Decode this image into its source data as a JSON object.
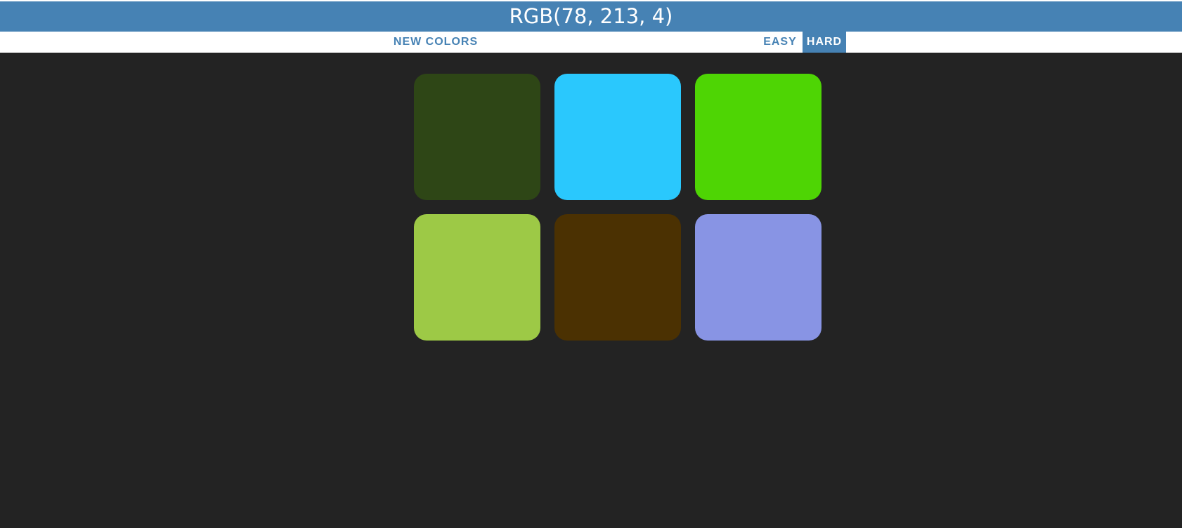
{
  "header": {
    "target_color": "RGB(78, 213, 4)"
  },
  "stripe": {
    "new_colors_label": "New Colors",
    "easy_label": "Easy",
    "hard_label": "Hard",
    "selected_mode": "hard"
  },
  "squares": [
    {
      "color": "#2e4616"
    },
    {
      "color": "#2ac8fd"
    },
    {
      "color": "#4ed504"
    },
    {
      "color": "#9dc946"
    },
    {
      "color": "#4b3102"
    },
    {
      "color": "#8894e4"
    }
  ],
  "colors": {
    "accent": "#4682b4",
    "background": "#232323",
    "header_text": "#ffffff"
  }
}
